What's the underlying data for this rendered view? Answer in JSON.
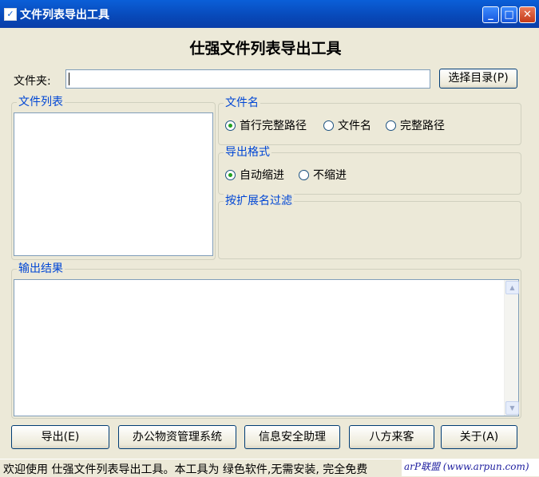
{
  "window": {
    "title": "文件列表导出工具",
    "minimize_glyph": "_",
    "maximize_glyph": "□",
    "close_glyph": "✕",
    "app_icon": "checkbox-icon"
  },
  "heading": "仕强文件列表导出工具",
  "folder": {
    "label": "文件夹:",
    "value": "",
    "choose_button": "选择目录(P)"
  },
  "file_list": {
    "label": "文件列表"
  },
  "filename_group": {
    "label": "文件名",
    "options": [
      "首行完整路径",
      "文件名",
      "完整路径"
    ],
    "selected": "首行完整路径"
  },
  "format_group": {
    "label": "导出格式",
    "options": [
      "自动缩进",
      "不缩进"
    ],
    "selected": "自动缩进"
  },
  "ext_filter": {
    "label": "按扩展名过滤"
  },
  "output": {
    "label": "输出结果",
    "value": ""
  },
  "buttons": {
    "export": "导出(E)",
    "office": "办公物资管理系统",
    "security": "信息安全助理",
    "bafang": "八方来客",
    "about": "关于(A)"
  },
  "status": {
    "text": "欢迎使用 仕强文件列表导出工具。本工具为 绿色软件,无需安装, 完全免费"
  },
  "watermark": "arP联盟 (www.arpun.com)",
  "colors": {
    "title_bar": "#0a54d0",
    "group_label": "#0046d5",
    "window_bg": "#ece9d8"
  }
}
